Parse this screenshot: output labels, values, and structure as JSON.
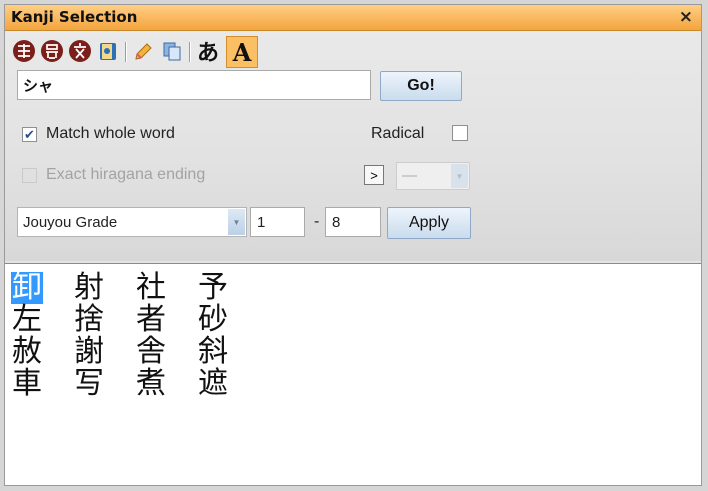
{
  "window": {
    "title": "Kanji Selection",
    "close": "×"
  },
  "toolbar": {
    "kana_button": "あ",
    "alpha_button": "A"
  },
  "search": {
    "value": "シャ",
    "go_label": "Go!"
  },
  "options": {
    "match_whole_word": "Match whole word",
    "match_whole_word_checked": true,
    "exact_hiragana": "Exact hiragana ending",
    "exact_hiragana_checked": false,
    "radical_label": "Radical",
    "radical_checked": false,
    "radical_arrow": ">",
    "radical_value": "—"
  },
  "grade": {
    "mode": "Jouyou Grade",
    "from": "1",
    "dash": "-",
    "to": "8",
    "apply_label": "Apply"
  },
  "results": {
    "kanji": [
      "卸",
      "射",
      "社",
      "予",
      "左",
      "捨",
      "者",
      "砂",
      "赦",
      "謝",
      "舎",
      "斜",
      "車",
      "写",
      "煮",
      "遮"
    ],
    "selected_index": 0
  },
  "colors": {
    "title_bar": "#f4a43e",
    "selection": "#3399ff"
  }
}
